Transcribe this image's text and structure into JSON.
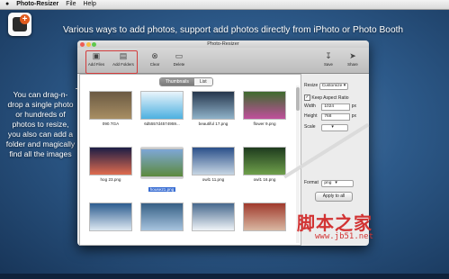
{
  "menubar": {
    "app_name": "Photo-Resizer",
    "items": [
      "File",
      "Help"
    ]
  },
  "headline": "Various ways to add photos, support add photos directly from iPhoto or Photo Booth",
  "sidenote": "You can drag-n-drop a single photo or hundreds of photos to resize, you also can add a folder and magically find all the images",
  "window": {
    "title": "Photo-Resizer",
    "toolbar": {
      "add_files": "Add Files",
      "add_folders": "Add Folders",
      "clear": "Clear",
      "delete": "Delete",
      "save": "Save",
      "share": "Share"
    },
    "tabs": [
      "Thumbnails",
      "List"
    ],
    "selected_tab": "Thumbnails",
    "thumbnails": [
      {
        "label": "090.TGA",
        "colors": [
          "#6b5a43",
          "#a88e63"
        ]
      },
      {
        "label": "6d5557d4574959...",
        "colors": [
          "#e9f4fb",
          "#4db0e0"
        ]
      },
      {
        "label": "beautiful 17.png",
        "colors": [
          "#26364c",
          "#8fb2c9"
        ]
      },
      {
        "label": "flower 9.png",
        "colors": [
          "#3d6a2d",
          "#c04f9c"
        ]
      },
      {
        "label": "hog 23.png",
        "colors": [
          "#1c1d45",
          "#e06c4f"
        ]
      },
      {
        "label": "house21.png",
        "colors": [
          "#7ea7d6",
          "#5c8a3d"
        ]
      },
      {
        "label": "owl1 11.png",
        "colors": [
          "#2a4f8a",
          "#c7d6e4"
        ]
      },
      {
        "label": "owl1 16.png",
        "colors": [
          "#1e3b1e",
          "#6fa04b"
        ]
      },
      {
        "label": "",
        "colors": [
          "#2c5c8f",
          "#dde8f2"
        ]
      },
      {
        "label": "",
        "colors": [
          "#365f85",
          "#a7c4df"
        ]
      },
      {
        "label": "",
        "colors": [
          "#46688d",
          "#f0f4f8"
        ]
      },
      {
        "label": "",
        "colors": [
          "#a03a2c",
          "#d9b7a2"
        ]
      }
    ],
    "selected_thumbnail": "house21.png",
    "panel": {
      "resize_label": "Resize",
      "resize_mode": "Customize",
      "keep_aspect_label": "Keep Aspect Ratio",
      "keep_aspect_checked": true,
      "width_label": "Width",
      "width_value": "1024",
      "width_unit": "px",
      "height_label": "Height",
      "height_value": "768",
      "height_unit": "px",
      "scale_label": "Scale",
      "format_label": "Format",
      "format_value": "png",
      "apply_label": "Apply to all"
    }
  },
  "watermark": {
    "text": "脚本之家",
    "url": "www.jb51.net"
  },
  "colors": {
    "highlight": "#d23c3c",
    "selection": "#3b6fd3",
    "watermark": "#d23333"
  }
}
